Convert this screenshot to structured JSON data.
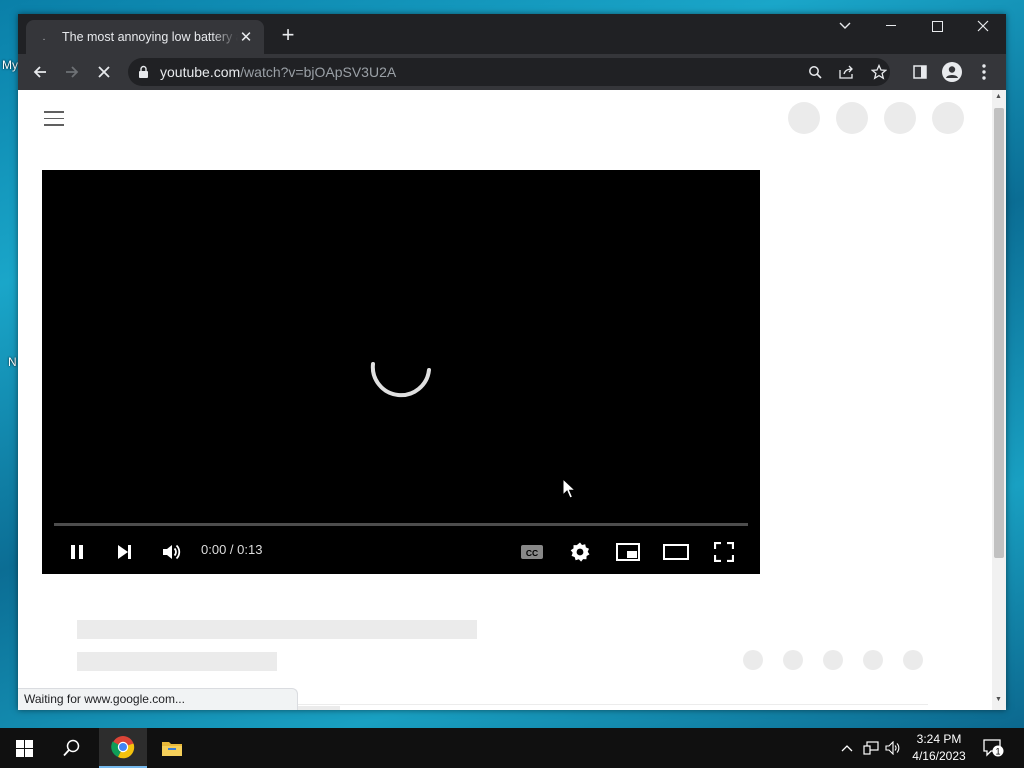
{
  "desktop": {
    "fragments": [
      "My",
      "N"
    ]
  },
  "browser": {
    "tab": {
      "favicon": ".",
      "title": "The most annoying low battery alert sound"
    },
    "url": {
      "domain": "youtube.com",
      "path": "/watch?v=bjOApSV3U2A"
    },
    "status_text": "Waiting for www.google.com..."
  },
  "player": {
    "time_display": "0:00 / 0:13",
    "progress": 0
  },
  "taskbar": {
    "time": "3:24 PM",
    "date": "4/16/2023",
    "notification_count": "1"
  },
  "colors": {
    "titlebar": "#202124",
    "toolbar": "#35363a",
    "taskbar_accent": "#76b9ed"
  }
}
